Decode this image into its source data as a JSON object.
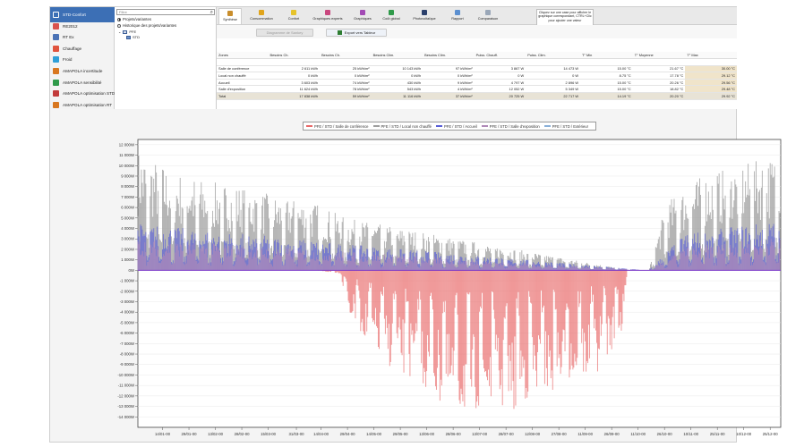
{
  "sidebar": {
    "items": [
      {
        "label": "STD-Confort",
        "icon": "thermal-comfort-icon",
        "color": "#3c6fb5",
        "active": true
      },
      {
        "label": "RE2012",
        "icon": "regulation-icon",
        "color": "#d9534f",
        "active": false
      },
      {
        "label": "RT Ex",
        "icon": "existing-building-icon",
        "color": "#4a72b5",
        "active": false
      },
      {
        "label": "Chauffage",
        "icon": "heating-icon",
        "color": "#e0533d",
        "active": false
      },
      {
        "label": "Froid",
        "icon": "cooling-icon",
        "color": "#2f9fd8",
        "active": false
      },
      {
        "label": "AMAPOLA incertitude",
        "icon": "amapola-icon",
        "color": "#d8771f",
        "active": false
      },
      {
        "label": "AMAPOLA sensibilité",
        "icon": "amapola-icon",
        "color": "#2f9a4a",
        "active": false
      },
      {
        "label": "AMAPOLA optimisation STD",
        "icon": "optimisation-icon",
        "color": "#c23b3b",
        "active": false
      },
      {
        "label": "AMAPOLA optimisation RT",
        "icon": "optimisation-icon",
        "color": "#d8771f",
        "active": false
      }
    ]
  },
  "tree": {
    "search_placeholder": "Filtre",
    "radio_projects": "Projets/variantes",
    "radio_history": "Historique des projets/variantes",
    "project": "PFE",
    "variant": "STD"
  },
  "tabs": [
    {
      "label": "Synthèse",
      "color": "#c98e2c",
      "selected": true
    },
    {
      "label": "Consommation",
      "color": "#e0a41c",
      "selected": false
    },
    {
      "label": "Confort",
      "color": "#e6c32b",
      "selected": false
    },
    {
      "label": "Graphiques experts",
      "color": "#c9477e",
      "selected": false
    },
    {
      "label": "Graphiques",
      "color": "#a34bb5",
      "selected": false
    },
    {
      "label": "Coût global",
      "color": "#2f9a4a",
      "selected": false
    },
    {
      "label": "Photovoltaïque",
      "color": "#2a3f6b",
      "selected": false
    },
    {
      "label": "Rapport",
      "color": "#5b8fd0",
      "selected": false
    },
    {
      "label": "Comparaison",
      "color": "#9aa7b8",
      "selected": false
    }
  ],
  "hint": "Cliquez sur une case pour afficher le graphique correspondant, CTRL+Clic pour ajouter une valeur",
  "toolbar": {
    "diagram_label": "Diagramme de Sankey",
    "export_label": "Export vers Tableur"
  },
  "table": {
    "headers": [
      "Zones",
      "Besoins Ch.",
      "Besoins Ch.",
      "Besoins Clim.",
      "Besoins Clim.",
      "Puiss. Chauff.",
      "Puiss. Clim.",
      "T° Min",
      "T° Moyenne",
      "T° Max"
    ],
    "rows": [
      {
        "zone": "Salle de conférence",
        "v": [
          "2 611 kWh",
          "25 kWh/m²",
          "10 143 kWh",
          "97 kWh/m²",
          "3 867 W",
          "14 473 W",
          "15.00 °C",
          "21.67 °C",
          "30.00 °C"
        ]
      },
      {
        "zone": "Local non chauffé",
        "v": [
          "0 kWh",
          "0 kWh/m²",
          "0 kWh",
          "0 kWh/m²",
          "0 W",
          "0 W",
          "8.75 °C",
          "17.78 °C",
          "29.12 °C"
        ]
      },
      {
        "zone": "Accueil",
        "v": [
          "3 603 kWh",
          "74 kWh/m²",
          "430 kWh",
          "9 kWh/m²",
          "4 797 W",
          "2 896 W",
          "15.00 °C",
          "20.26 °C",
          "29.56 °C"
        ]
      },
      {
        "zone": "Salle d'exposition",
        "v": [
          "11 624 kWh",
          "78 kWh/m²",
          "543 kWh",
          "4 kWh/m²",
          "12 052 W",
          "5 349 W",
          "15.00 °C",
          "18.82 °C",
          "29.48 °C"
        ]
      },
      {
        "zone": "Total",
        "v": [
          "17 838 kWh",
          "59 kWh/m²",
          "11 116 kWh",
          "37 kWh/m²",
          "20 725 W",
          "22 717 W",
          "14.19 °C",
          "20.20 °C",
          "29.92 °C"
        ]
      }
    ]
  },
  "legend": [
    {
      "label": "PFE / STD / Salle de conférence",
      "color": "#e86a6a"
    },
    {
      "label": "PFE / STD / Local non chauffé",
      "color": "#9f9f9f"
    },
    {
      "label": "PFE / STD / Accueil",
      "color": "#5a5fd6"
    },
    {
      "label": "PFE / STD / Salle d'exposition",
      "color": "#b08ab8"
    },
    {
      "label": "PFE / STD / Extérieur",
      "color": "#8ab0d8"
    }
  ],
  "chart_data": {
    "type": "bar",
    "ylabel": "",
    "ylim": [
      -15000,
      12500
    ],
    "y_ticks": [
      "12 000W",
      "11 000W",
      "10 000W",
      "9 000W",
      "8 000W",
      "7 000W",
      "6 000W",
      "5 000W",
      "4 000W",
      "3 000W",
      "2 000W",
      "1 000W",
      "0W",
      "-1 000W",
      "-2 000W",
      "-3 000W",
      "-4 000W",
      "-5 000W",
      "-6 000W",
      "-7 000W",
      "-8 000W",
      "-9 000W",
      "-10 000W",
      "-11 000W",
      "-12 000W",
      "-13 000W",
      "-14 000W"
    ],
    "y_values": [
      12000,
      11000,
      10000,
      9000,
      8000,
      7000,
      6000,
      5000,
      4000,
      3000,
      2000,
      1000,
      0,
      -1000,
      -2000,
      -3000,
      -4000,
      -5000,
      -6000,
      -7000,
      -8000,
      -9000,
      -10000,
      -11000,
      -12000,
      -13000,
      -14000
    ],
    "x_ticks": [
      "14/01-00",
      "29/01-00",
      "13/02-00",
      "28/02-00",
      "15/03-00",
      "31/03-00",
      "14/04-00",
      "29/04-00",
      "14/05-00",
      "29/05-00",
      "13/06-00",
      "28/06-00",
      "13/07-00",
      "28/07-00",
      "12/08-00",
      "27/08-00",
      "11/09-00",
      "26/09-00",
      "11/10-00",
      "26/10-00",
      "10/11-00",
      "25/11-00",
      "10/12-00",
      "25/12-00"
    ],
    "x_tick_days": [
      14,
      29,
      44,
      59,
      74,
      90,
      104,
      119,
      134,
      149,
      164,
      179,
      194,
      209,
      224,
      239,
      254,
      269,
      284,
      299,
      314,
      329,
      344,
      359
    ],
    "days": 365,
    "series": [
      {
        "name": "PFE / STD / Local non chauffé",
        "color": "#9f9f9f",
        "heating_envelope_days": [
          0,
          20,
          40,
          60,
          80,
          100,
          118,
          280,
          290,
          300,
          320,
          340,
          365
        ],
        "heating_envelope_w": [
          11500,
          9500,
          8500,
          8000,
          7000,
          6500,
          5000,
          0,
          0,
          6500,
          9000,
          10000,
          11000
        ]
      },
      {
        "name": "PFE / STD / Salle de conférence",
        "color": "#e86a6a",
        "cooling_envelope_days": [
          0,
          100,
          115,
          120,
          140,
          160,
          180,
          200,
          210,
          220,
          240,
          260,
          275,
          278,
          365
        ],
        "cooling_envelope_w": [
          0,
          0,
          -300,
          -4500,
          -9000,
          -11000,
          -14000,
          -13000,
          -14500,
          -12500,
          -11500,
          -10000,
          -6000,
          0,
          0
        ]
      },
      {
        "name": "PFE / STD / Accueil",
        "color": "#5a5fd6",
        "heating_envelope_days": [
          0,
          40,
          80,
          118,
          290,
          310,
          365
        ],
        "heating_envelope_w": [
          4500,
          3800,
          3200,
          2500,
          0,
          3500,
          4800
        ]
      },
      {
        "name": "PFE / STD / Salle d'exposition",
        "color": "#b08ab8",
        "heating_envelope_days": [
          0,
          40,
          80,
          118,
          290,
          310,
          365
        ],
        "heating_envelope_w": [
          3000,
          2600,
          2200,
          1800,
          0,
          2200,
          3200
        ]
      }
    ]
  }
}
